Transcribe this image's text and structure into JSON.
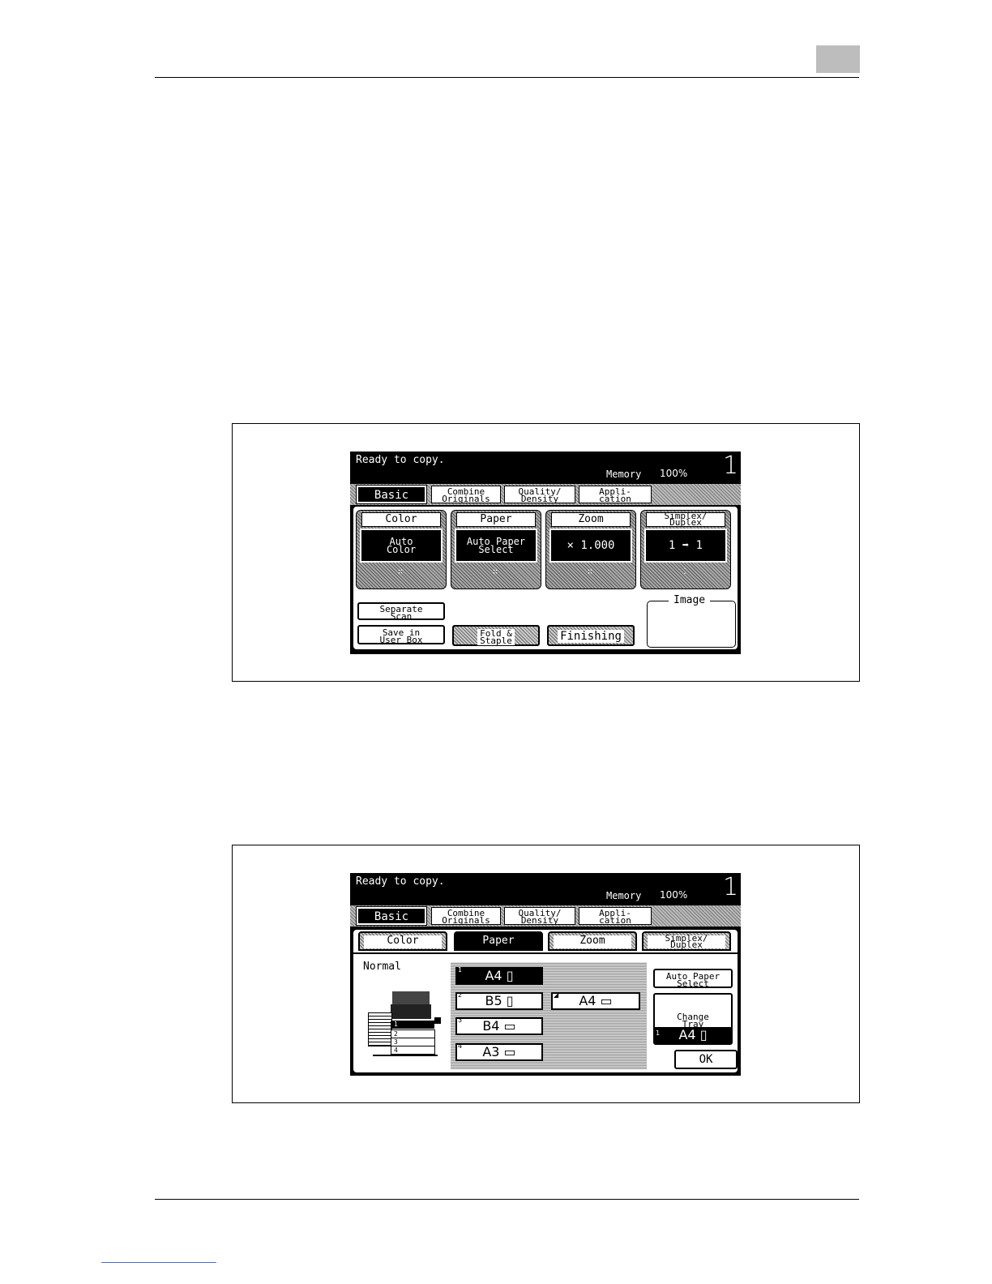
{
  "status_text": "Ready to copy.",
  "memory_label": "Memory",
  "memory_value": "100%",
  "copy_count": "1",
  "tabs": [
    "Basic",
    "Combine\nOriginals",
    "Quality/\nDensity",
    "Appli-\ncation"
  ],
  "screen1": {
    "functions": [
      {
        "label": "Color",
        "value": "Auto\nColor"
      },
      {
        "label": "Paper",
        "value": "Auto Paper\nSelect"
      },
      {
        "label": "Zoom",
        "value": "× 1.000"
      },
      {
        "label": "Simplex/\nDuplex",
        "value": "1 ➡ 1"
      }
    ],
    "separate_scan": "Separate\nScan",
    "save_user_box": "Save in\nUser Box",
    "fold_staple": "Fold &\nStaple",
    "finishing": "Finishing",
    "image_label": "Image"
  },
  "screen2": {
    "subtabs": [
      "Color",
      "Paper",
      "Zoom",
      "Simplex/\nDuplex"
    ],
    "normal_label": "Normal",
    "trays": [
      {
        "num": "1",
        "label": "A4 ▯"
      },
      {
        "num": "2",
        "label": "B5 ▯"
      },
      {
        "num": "3",
        "label": "B4 ▭"
      },
      {
        "num": "4",
        "label": "A3 ▭"
      },
      {
        "num": "◢",
        "label": "A4 ▭"
      }
    ],
    "auto_paper_select": "Auto Paper\nSelect",
    "change_tray_settings": "Change\nTray\nSettings",
    "selected_tray_num": "1",
    "selected_tray": "A4 ▯",
    "ok": "OK",
    "machine_trays": [
      "1",
      "2",
      "3",
      "4"
    ]
  }
}
